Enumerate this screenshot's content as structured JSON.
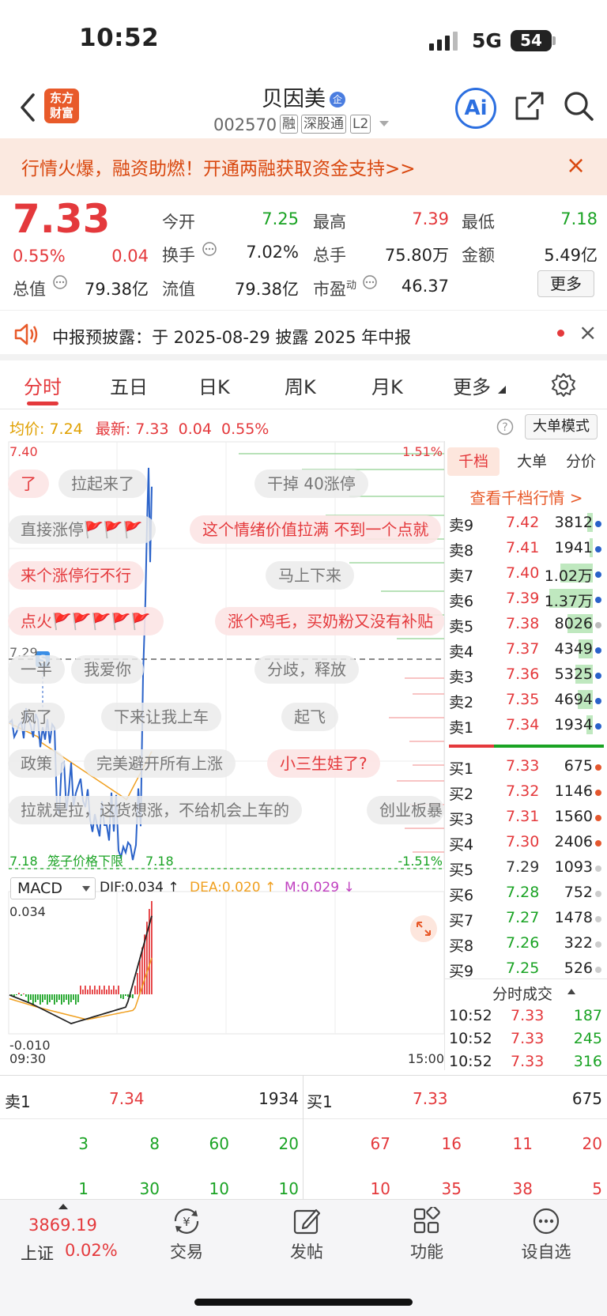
{
  "status": {
    "time": "10:52",
    "network": "5G",
    "battery": "54"
  },
  "header": {
    "back_icon": "chevron-left-icon",
    "logo_line1": "东方",
    "logo_line2": "财富",
    "name": "贝因美",
    "name_badge": "企",
    "code": "002570",
    "tags": [
      "融",
      "深股通",
      "L2"
    ],
    "ai_label": "Ai",
    "share_icon": "share-icon",
    "search_icon": "search-icon"
  },
  "promo": {
    "text": "行情火爆，融资助燃！开通两融获取资金支持>>",
    "close": "×"
  },
  "quote": {
    "price": "7.33",
    "change_pct": "0.55%",
    "change": "0.04",
    "open_label": "今开",
    "open": "7.25",
    "high_label": "最高",
    "high": "7.39",
    "low_label": "最低",
    "low": "7.18",
    "turnover_label": "换手",
    "turnover": "7.02%",
    "volume_label": "总手",
    "volume": "75.80万",
    "amount_label": "金额",
    "amount": "5.49亿",
    "mcap_label": "总值",
    "mcap": "79.38亿",
    "float_label": "流值",
    "float": "79.38亿",
    "pe_label": "市盈",
    "pe_sup": "动",
    "pe": "46.37",
    "more": "更多"
  },
  "notice": {
    "text": "中报预披露：于 2025-08-29 披露 2025 年中报",
    "close": "×"
  },
  "tabs": [
    "分时",
    "五日",
    "日K",
    "周K",
    "月K",
    "更多"
  ],
  "chart_info": {
    "avg_label": "均价:",
    "avg": "7.24",
    "last_label": "最新:",
    "last": "7.33",
    "chg": "0.04",
    "pct": "0.55%",
    "mode_btn": "大单模式"
  },
  "chart_labels": {
    "top_price": "7.40",
    "top_pct": "1.51%",
    "prev_close": "7.29",
    "bottom_price": "7.18",
    "bottom_pct": "-1.51%",
    "limit_text": "笼子价格下限",
    "limit_price": "7.18",
    "macd_select": "MACD",
    "dif": "DIF:0.034 ↑",
    "dea": "DEA:0.020 ↑",
    "m": "M:0.029 ↓",
    "macd_top": "0.034",
    "macd_bottom": "-0.010",
    "time_start": "09:30",
    "time_end": "15:00",
    "s_marker": "S"
  },
  "danmu": [
    {
      "text": "了",
      "style": "r"
    },
    {
      "text": "拉起来了",
      "style": "g"
    },
    {
      "text": "干掉 40涨停",
      "style": "g"
    },
    {
      "text": "直接涨停🚩🚩🚩",
      "style": "g"
    },
    {
      "text": "这个情绪价值拉满 不到一个点就",
      "style": "r"
    },
    {
      "text": "来个涨停行不行",
      "style": "r"
    },
    {
      "text": "马上下来",
      "style": "g"
    },
    {
      "text": "点火🚩🚩🚩🚩🚩",
      "style": "r"
    },
    {
      "text": "涨个鸡毛，买奶粉又没有补贴",
      "style": "r"
    },
    {
      "text": "一半",
      "style": "g"
    },
    {
      "text": "我爱你",
      "style": "g"
    },
    {
      "text": "分歧，释放",
      "style": "g"
    },
    {
      "text": "疯了",
      "style": "g"
    },
    {
      "text": "下来让我上车",
      "style": "g"
    },
    {
      "text": "起飞",
      "style": "g"
    },
    {
      "text": "政策",
      "style": "g"
    },
    {
      "text": "完美避开所有上涨",
      "style": "g"
    },
    {
      "text": "小三生娃了?",
      "style": "r"
    },
    {
      "text": "拉就是拉，这货想涨，不给机会上车的",
      "style": "g"
    },
    {
      "text": "创业板暴",
      "style": "g"
    }
  ],
  "orderbook": {
    "tabs": [
      "千档",
      "大单",
      "分价"
    ],
    "link": "查看千档行情 >",
    "asks": [
      {
        "label": "卖9",
        "price": "7.42",
        "vol": "3812",
        "pc": "r",
        "fill": 0.12,
        "dot": "#2a62c9"
      },
      {
        "label": "卖8",
        "price": "7.41",
        "vol": "1941",
        "pc": "r",
        "fill": 0.06,
        "dot": "#2a62c9"
      },
      {
        "label": "卖7",
        "price": "7.40",
        "vol": "1.02万",
        "pc": "r",
        "fill": 0.68,
        "dot": "#2a62c9"
      },
      {
        "label": "卖6",
        "price": "7.39",
        "vol": "1.37万",
        "pc": "r",
        "fill": 0.92,
        "dot": "#2a62c9"
      },
      {
        "label": "卖5",
        "price": "7.38",
        "vol": "8026",
        "pc": "r",
        "fill": 0.54,
        "dot": "#bbbbbb"
      },
      {
        "label": "卖4",
        "price": "7.37",
        "vol": "4349",
        "pc": "r",
        "fill": 0.3,
        "dot": "#2a62c9"
      },
      {
        "label": "卖3",
        "price": "7.36",
        "vol": "5325",
        "pc": "r",
        "fill": 0.36,
        "dot": "#2a62c9"
      },
      {
        "label": "卖2",
        "price": "7.35",
        "vol": "4694",
        "pc": "r",
        "fill": 0.32,
        "dot": "#2a62c9"
      },
      {
        "label": "卖1",
        "price": "7.34",
        "vol": "1934",
        "pc": "r",
        "fill": 0.13,
        "dot": "#2a62c9"
      }
    ],
    "bids": [
      {
        "label": "买1",
        "price": "7.33",
        "vol": "675",
        "pc": "r",
        "dot": "#e4572e"
      },
      {
        "label": "买2",
        "price": "7.32",
        "vol": "1146",
        "pc": "r",
        "dot": "#e4572e"
      },
      {
        "label": "买3",
        "price": "7.31",
        "vol": "1560",
        "pc": "r",
        "dot": "#e4572e"
      },
      {
        "label": "买4",
        "price": "7.30",
        "vol": "2406",
        "pc": "r",
        "dot": "#e4572e"
      },
      {
        "label": "买5",
        "price": "7.29",
        "vol": "1093",
        "pc": "k",
        "dot": "#cccccc"
      },
      {
        "label": "买6",
        "price": "7.28",
        "vol": "752",
        "pc": "g",
        "dot": "#cccccc"
      },
      {
        "label": "买7",
        "price": "7.27",
        "vol": "1478",
        "pc": "g",
        "dot": "#cccccc"
      },
      {
        "label": "买8",
        "price": "7.26",
        "vol": "322",
        "pc": "g",
        "dot": "#cccccc"
      },
      {
        "label": "买9",
        "price": "7.25",
        "vol": "526",
        "pc": "g",
        "dot": "#cccccc"
      }
    ],
    "ticks_header": "分时成交",
    "ticks": [
      {
        "time": "10:52",
        "price": "7.33",
        "vol": "187"
      },
      {
        "time": "10:52",
        "price": "7.33",
        "vol": "245"
      },
      {
        "time": "10:52",
        "price": "7.33",
        "vol": "316"
      }
    ]
  },
  "level1": {
    "sell_label": "卖1",
    "sell_price": "7.34",
    "sell_vol": "1934",
    "buy_label": "买1",
    "buy_price": "7.33",
    "buy_vol": "675",
    "sell_q1": [
      "3",
      "8",
      "60",
      "20"
    ],
    "sell_q2": [
      "1",
      "30",
      "10",
      "10"
    ],
    "buy_q1": [
      "67",
      "16",
      "11",
      "20"
    ],
    "buy_q2": [
      "10",
      "35",
      "38",
      "5"
    ]
  },
  "bottom_nav": {
    "index_value": "3869.19",
    "index_name": "上证",
    "index_pct": "0.02%",
    "items": [
      {
        "label": "交易",
        "icon": "yuan-exchange-icon"
      },
      {
        "label": "发帖",
        "icon": "edit-icon"
      },
      {
        "label": "功能",
        "icon": "grid-icon"
      },
      {
        "label": "设自选",
        "icon": "more-dots-icon"
      }
    ]
  },
  "colors": {
    "up": "#e4393c",
    "down": "#1aa324",
    "price_line": "#2a62c9",
    "avg_line": "#f0a020",
    "accent": "#d9480f"
  }
}
